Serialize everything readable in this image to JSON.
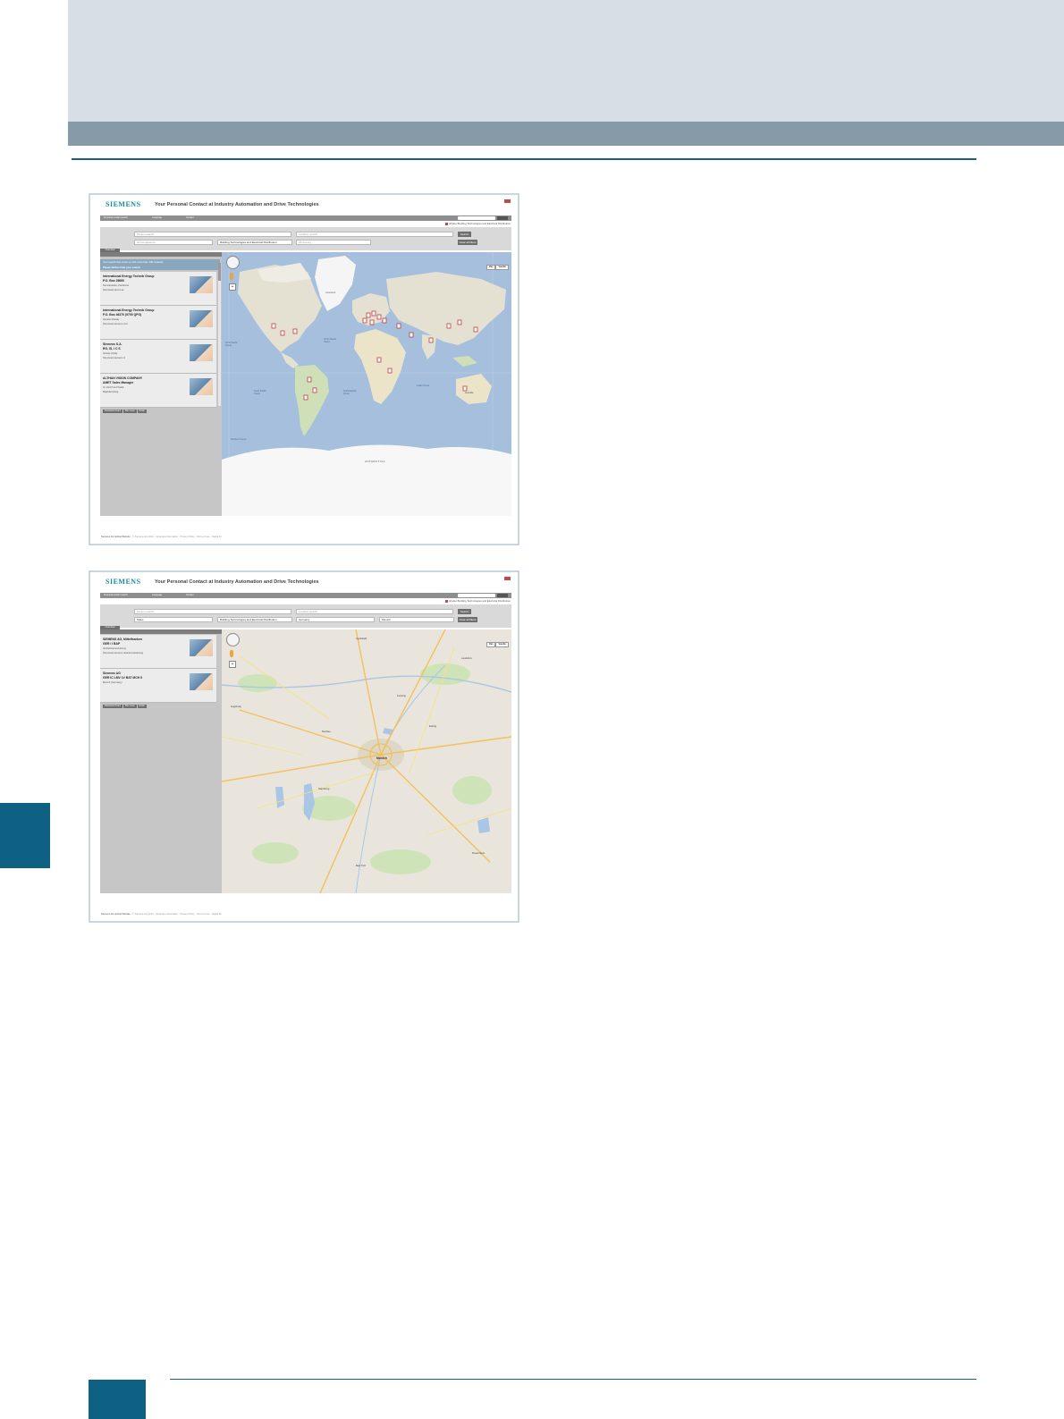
{
  "screenshots": [
    {
      "logo": "SIEMENS",
      "title": "Your Personal Contact at Industry Automation and Drive Technologies",
      "nav": [
        "Personal contact search",
        "Language",
        "Contact"
      ],
      "also_checkbox": "All also Building Technologies and Electrical Distribution",
      "search": {
        "person_placeholder": "Person search",
        "location_placeholder": "Location search",
        "competence": "All competence",
        "division": "Building Technologies and Electrical Distribution",
        "country": "All country",
        "product": "",
        "search_label": "Search",
        "clear_label": "Clear all filters"
      },
      "overview_tab": "Overview",
      "notice_line1": "Your search has come up with more than 100 contacts",
      "notice_line2": "Please further limit your search",
      "contacts": [
        {
          "l1": "International Energy Technik Group",
          "l2": "P.O. Box 28660",
          "l3": "Demokratisko, Pandemia",
          "l4": "http://www.siel.co.ae",
          "actions": [
            "Download vCard",
            "Plan route",
            "Email"
          ]
        },
        {
          "l1": "International Energy Technik Group",
          "l2": "P.O. Box 46270 (9700 QPO)",
          "l3": "Hamitoo Dietaly",
          "l4": "http://www.siemens.com",
          "actions": [
            "Download vCard",
            "Plan route",
            "Email"
          ]
        },
        {
          "l1": "Siemens S.A.",
          "l2": "RG, IS, I C S",
          "l3": "Ventas (Chile)",
          "l4": "http://www.siemens.cl",
          "actions": [
            "Download vCard",
            "Plan route",
            "Email"
          ]
        },
        {
          "l1": "ALTHAN VISION COMPANY",
          "l2": "AMET Sales Manager",
          "l3": "Gr. Zurich Al-Chaleb",
          "l4": "Baghdad (Iraq)",
          "actions": [
            "Download vCard",
            "Plan route",
            "Email"
          ]
        }
      ],
      "map_types": [
        "Map",
        "Satellite"
      ],
      "map_labels": {
        "greenland": "Greenland",
        "n_pacific": "North Pacific Ocean",
        "n_atlantic": "North Atlantic Ocean",
        "s_pacific": "South Pacific Ocean",
        "s_atlantic": "South Atlantic Ocean",
        "indian": "Indian Ocean",
        "southern": "Southern Ocean",
        "antarctica": "ANTARCTICA",
        "australia": "Australia"
      },
      "footer": [
        "Siemens AG Global Website",
        "© Siemens AG 2014",
        "Corporate Information",
        "Privacy Policy",
        "Terms of use",
        "Digital ID"
      ]
    },
    {
      "logo": "SIEMENS",
      "title": "Your Personal Contact at Industry Automation and Drive Technologies",
      "nav": [
        "Personal contact search",
        "Language",
        "Contact"
      ],
      "also_checkbox": "All also Building Technologies and Electrical Distribution",
      "search": {
        "person_placeholder": "Person search",
        "location_placeholder": "Location search",
        "competence": "Sales",
        "division": "Building Technologies and Electrical Distribution",
        "country": "Germany",
        "product": "Munich",
        "search_label": "Search",
        "clear_label": "Clear all filters"
      },
      "overview_tab": "Overview",
      "contacts": [
        {
          "l1": "SIEMENS AG, Mittelfranken",
          "l2": "GER / I BAP",
          "l3": "Vertriebsunterstützung",
          "l4": "http://www.siemens.de/automatisierung",
          "actions": [
            "Download vCard",
            "Plan route",
            "Email"
          ]
        },
        {
          "l1": "Siemens AG",
          "l2": "GER IC LMV LV BAT MCH II",
          "l3": "Munich (Germany)",
          "l4": "",
          "actions": [
            "Download vCard",
            "Plan route",
            "Email"
          ]
        }
      ],
      "map_types": [
        "Map",
        "Satellite"
      ],
      "map_labels": {
        "munich": "Munich",
        "augsburg": "Augsburg",
        "landshut": "Landshut",
        "rosenheim": "Rosenheim",
        "freising": "Freising",
        "dachau": "Dachau",
        "erding": "Erding",
        "bad_toelz": "Bad Tölz",
        "starnberg": "Starnberg",
        "ingolstadt": "Ingolstadt"
      },
      "footer": [
        "Siemens AG Global Website",
        "© Siemens AG 2014",
        "Corporate Information",
        "Privacy Policy",
        "Terms of use",
        "Digital ID"
      ]
    }
  ]
}
